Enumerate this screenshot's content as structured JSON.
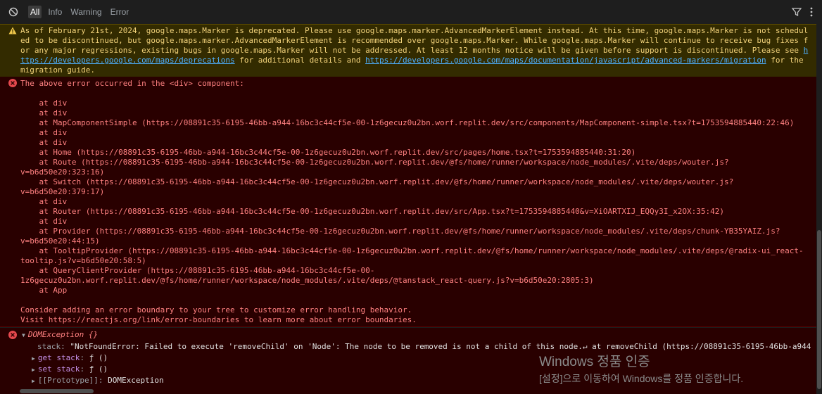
{
  "toolbar": {
    "tabs": [
      {
        "label": "All",
        "active": true
      },
      {
        "label": "Info",
        "active": false
      },
      {
        "label": "Warning",
        "active": false
      },
      {
        "label": "Error",
        "active": false
      }
    ],
    "icons": {
      "clear": "clear-console-icon",
      "filter": "filter-icon",
      "settings": "more-options-icon"
    }
  },
  "warning": {
    "text_1": "As of February 21st, 2024, google.maps.Marker is deprecated. Please use google.maps.marker.AdvancedMarkerElement instead. At this time, google.maps.Marker is not scheduled to be discontinued, but google.maps.marker.AdvancedMarkerElement is recommended over google.maps.Marker. While google.maps.Marker will continue to receive bug fixes for any major regressions, existing bugs in google.maps.Marker will not be addressed. At least 12 months notice will be given before support is discontinued. Please see ",
    "link_1": "https://developers.google.com/maps/deprecations",
    "text_2": " for additional details and ",
    "link_2": "https://developers.google.com/maps/documentation/javascript/advanced-markers/migration",
    "text_3": " for the migration guide.",
    "color": "#f2d27a"
  },
  "error": {
    "message": "The above error occurred in the <div> component:\n\n    at div\n    at div\n    at MapComponentSimple (https://08891c35-6195-46bb-a944-16bc3c44cf5e-00-1z6gecuz0u2bn.worf.replit.dev/src/components/MapComponent-simple.tsx?t=1753594885440:22:46)\n    at div\n    at div\n    at Home (https://08891c35-6195-46bb-a944-16bc3c44cf5e-00-1z6gecuz0u2bn.worf.replit.dev/src/pages/home.tsx?t=1753594885440:31:20)\n    at Route (https://08891c35-6195-46bb-a944-16bc3c44cf5e-00-1z6gecuz0u2bn.worf.replit.dev/@fs/home/runner/workspace/node_modules/.vite/deps/wouter.js?\nv=b6d50e20:323:16)\n    at Switch (https://08891c35-6195-46bb-a944-16bc3c44cf5e-00-1z6gecuz0u2bn.worf.replit.dev/@fs/home/runner/workspace/node_modules/.vite/deps/wouter.js?\nv=b6d50e20:379:17)\n    at div\n    at Router (https://08891c35-6195-46bb-a944-16bc3c44cf5e-00-1z6gecuz0u2bn.worf.replit.dev/src/App.tsx?t=1753594885440&v=XiOARTXIJ_EQQy3I_x2OX:35:42)\n    at div\n    at Provider (https://08891c35-6195-46bb-a944-16bc3c44cf5e-00-1z6gecuz0u2bn.worf.replit.dev/@fs/home/runner/workspace/node_modules/.vite/deps/chunk-YB35YAIZ.js?\nv=b6d50e20:44:15)\n    at TooltipProvider (https://08891c35-6195-46bb-a944-16bc3c44cf5e-00-1z6gecuz0u2bn.worf.replit.dev/@fs/home/runner/workspace/node_modules/.vite/deps/@radix-ui_react-\ntooltip.js?v=b6d50e20:58:5)\n    at QueryClientProvider (https://08891c35-6195-46bb-a944-16bc3c44cf5e-00-\n1z6gecuz0u2bn.worf.replit.dev/@fs/home/runner/workspace/node_modules/.vite/deps/@tanstack_react-query.js?v=b6d50e20:2805:3)\n    at App\n\nConsider adding an error boundary to your tree to customize error handling behavior.\nVisit https://reactjs.org/link/error-boundaries to learn more about error boundaries.",
    "color": "#ff8080"
  },
  "exception": {
    "title": "DOMException {}",
    "stack_key": "stack",
    "stack_value": "\"NotFoundError: Failed to execute 'removeChild' on 'Node': The node to be removed is not a child of this node.↵ at removeChild (https://08891c35-6195-46bb-a944",
    "getter_key": "get stack",
    "getter_value": "ƒ ()",
    "setter_key": "set stack",
    "setter_value": "ƒ ()",
    "proto_key": "[[Prototype]]",
    "proto_value": "DOMException"
  },
  "watermark": {
    "line1": "Windows 정품 인증",
    "line2": "[설정]으로 이동하여 Windows를 정품 인증합니다."
  }
}
